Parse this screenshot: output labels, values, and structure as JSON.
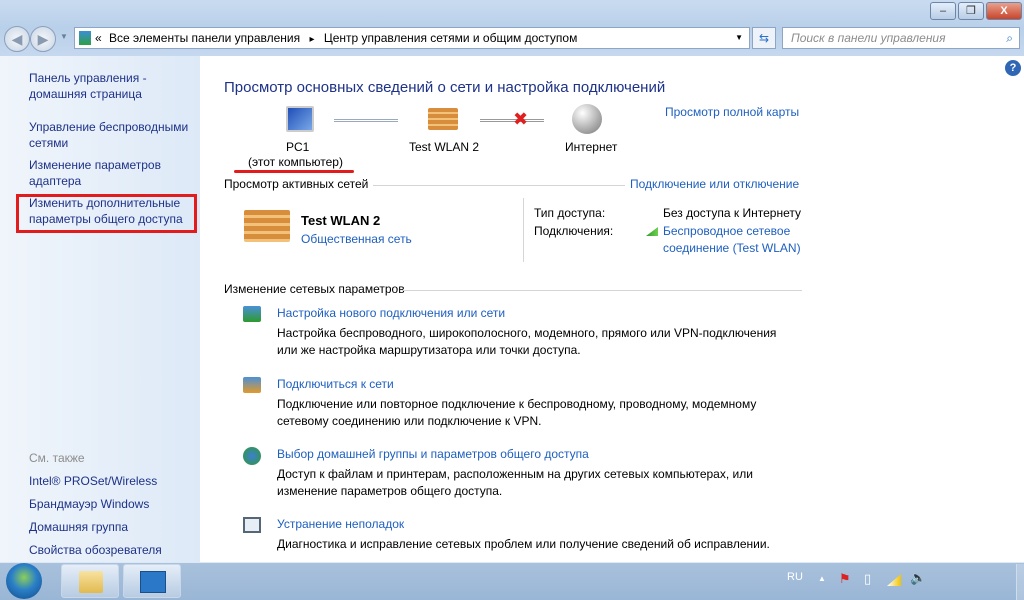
{
  "window": {
    "min": "–",
    "max": "❐",
    "close": "X"
  },
  "address": {
    "sep": "«",
    "crumb1": "Все элементы панели управления",
    "arrow": "▸",
    "crumb2": "Центр управления сетями и общим доступом",
    "search_placeholder": "Поиск в панели управления"
  },
  "sidebar": {
    "items": [
      "Панель управления - домашняя страница",
      "Управление беспроводными сетями",
      "Изменение параметров адаптера",
      "Изменить дополнительные параметры общего доступа"
    ],
    "see_also": "См. также",
    "see_items": [
      "Intel® PROSet/Wireless",
      "Брандмауэр Windows",
      "Домашняя группа",
      "Свойства обозревателя"
    ]
  },
  "main": {
    "title": "Просмотр основных сведений о сети и настройка подключений",
    "map": {
      "pc": "PC1",
      "pc_sub": "(этот компьютер)",
      "network": "Test WLAN  2",
      "internet": "Интернет",
      "full_map": "Просмотр полной карты"
    },
    "active": {
      "header": "Просмотр активных сетей",
      "connect_link": "Подключение или отключение",
      "name": "Test WLAN  2",
      "type": "Общественная сеть",
      "access_label": "Тип доступа:",
      "access_value": "Без доступа к Интернету",
      "conn_label": "Подключения:",
      "conn_value1": "Беспроводное сетевое",
      "conn_value2": "соединение (Test WLAN)"
    },
    "change": {
      "header": "Изменение сетевых параметров",
      "tasks": [
        {
          "title": "Настройка нового подключения или сети",
          "d1": "Настройка беспроводного, широкополосного, модемного, прямого или VPN-подключения",
          "d2": "или же настройка маршрутизатора или точки доступа."
        },
        {
          "title": "Подключиться к сети",
          "d1": "Подключение или повторное подключение к беспроводному, проводному, модемному",
          "d2": "сетевому соединению или подключение к VPN."
        },
        {
          "title": "Выбор домашней группы и параметров общего доступа",
          "d1": "Доступ к файлам и принтерам, расположенным на других сетевых компьютерах, или",
          "d2": "изменение параметров общего доступа."
        },
        {
          "title": "Устранение неполадок",
          "d1": "Диагностика и исправление сетевых проблем или получение сведений об исправлении.",
          "d2": ""
        }
      ]
    }
  },
  "taskbar": {
    "lang": "RU"
  },
  "help": "?"
}
